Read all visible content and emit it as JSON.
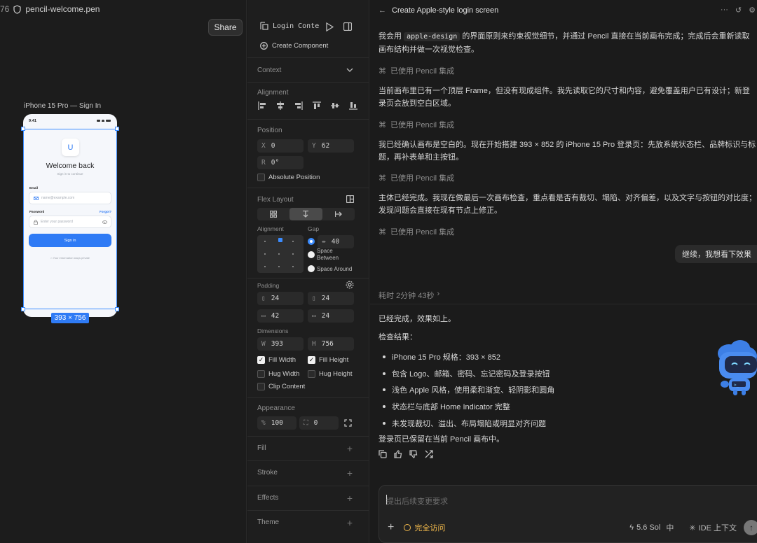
{
  "tab": {
    "line_number": "76",
    "file_name": "pencil-welcome.pen"
  },
  "canvas": {
    "share_label": "Share",
    "frame_label": "iPhone 15 Pro — Sign In",
    "size_badge": "393 × 756",
    "accent": "#2f7bf5"
  },
  "phone": {
    "time": "9:41",
    "logo_letter": "U",
    "title": "Welcome back",
    "subtitle": "Sign in to continue",
    "email_label": "Email",
    "email_placeholder": "name@example.com",
    "password_label": "Password",
    "forgot_label": "Forgot?",
    "password_placeholder": "Enter your password",
    "signin_label": "Sign in",
    "privacy_text": "Your information stays private"
  },
  "props": {
    "component_name": "Login Conte",
    "create_component": "Create Component",
    "context_title": "Context",
    "alignment_title": "Alignment",
    "position_title": "Position",
    "x_key": "X",
    "x_val": "0",
    "y_key": "Y",
    "y_val": "62",
    "r_key": "R",
    "r_val": "0°",
    "absolute_position": "Absolute Position",
    "flex_title": "Flex Layout",
    "flex_alignment": "Alignment",
    "gap_title": "Gap",
    "gap_val": "40",
    "space_between": "Space Between",
    "space_around": "Space Around",
    "padding_title": "Padding",
    "pad_left": "24",
    "pad_right": "24",
    "pad_top": "42",
    "pad_bottom": "24",
    "dimensions_title": "Dimensions",
    "w_key": "W",
    "w_val": "393",
    "h_key": "H",
    "h_val": "756",
    "fill_width": "Fill Width",
    "fill_height": "Fill Height",
    "hug_width": "Hug Width",
    "hug_height": "Hug Height",
    "clip_content": "Clip Content",
    "appearance_title": "Appearance",
    "opacity_key": "%",
    "opacity_val": "100",
    "radius_val": "0",
    "fill_title": "Fill",
    "stroke_title": "Stroke",
    "effects_title": "Effects",
    "theme_title": "Theme"
  },
  "chat": {
    "title": "Create Apple-style login screen",
    "msg1_pre": "我会用",
    "msg1_code": "apple-design",
    "msg1_post": "的界面原则来约束视觉细节，并通过 Pencil 直接在当前画布完成；完成后会重新读取画布结构并做一次视觉检查。",
    "tool_label": "已使用 Pencil 集成",
    "msg2": "当前画布里已有一个顶层 Frame，但没有现成组件。我先读取它的尺寸和内容，避免覆盖用户已有设计；新登录页会放到空白区域。",
    "msg3": "我已经确认画布是空白的。现在开始搭建 393 × 852 的 iPhone 15 Pro 登录页：先放系统状态栏、品牌标识与标题，再补表单和主按钮。",
    "msg4": "主体已经完成。我现在做最后一次画布检查，重点看是否有裁切、塌陷、对齐偏差，以及文字与按钮的对比度；发现问题会直接在现有节点上修正。",
    "user_msg": "继续，我想看下效果",
    "elapsed": "耗时 2分钟 43秒",
    "done": "已经完成，效果如上。",
    "check_title": "检查结果：",
    "results": [
      "iPhone 15 Pro 规格：393 × 852",
      "包含 Logo、邮箱、密码、忘记密码及登录按钮",
      "浅色 Apple 风格，使用柔和渐变、轻阴影和圆角",
      "状态栏与底部 Home Indicator 完整",
      "未发现裁切、溢出、布局塌陷或明显对齐问题"
    ],
    "final": "登录页已保留在当前 Pencil 画布中。",
    "input_placeholder": "提出后续变更要求",
    "access_label": "完全访问",
    "model_label": "5.6 Sol",
    "effort_label": "中",
    "ide_label": "IDE 上下文",
    "access_color": "#f0b84b"
  }
}
